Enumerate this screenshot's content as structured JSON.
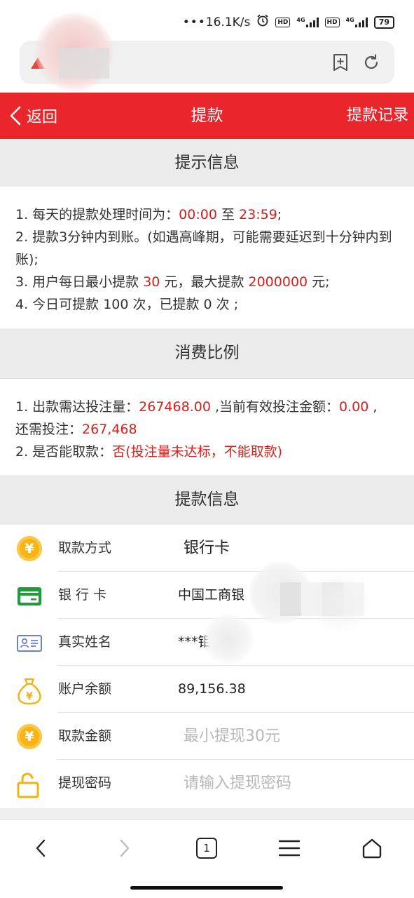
{
  "status_bar": {
    "network_speed": "16.1K/s",
    "hd1": "HD",
    "net1": "4G",
    "hd2": "HD",
    "net2": "4G",
    "battery": "79"
  },
  "browser": {
    "icons": [
      "warning-icon",
      "bookmark-add-icon",
      "refresh-icon"
    ]
  },
  "header": {
    "back_label": "返回",
    "title": "提款",
    "records_label": "提款记录"
  },
  "tips": {
    "title": "提示信息",
    "line1_prefix": "1. 每天的提款处理时间为：",
    "time_start": "00:00",
    "line1_mid": " 至 ",
    "time_end": "23:59",
    "line1_suffix": ";",
    "line2": "2. 提款3分钟内到账。(如遇高峰期，可能需要延迟到十分钟内到账);",
    "line3_prefix": "3. 用户每日最小提款 ",
    "min_amount": "30",
    "line3_mid": " 元，最大提款 ",
    "max_amount": "2000000",
    "line3_suffix": " 元;",
    "line4": "4. 今日可提款 100 次，已提款 0 次 ;"
  },
  "ratio": {
    "title": "消费比例",
    "line1_prefix": "1. 出款需达投注量：",
    "required_bet": "267468.00",
    "line1_mid": " ,当前有效投注金额：",
    "current_bet": "0.00",
    "line1_suffix": " ,",
    "line2_prefix": "还需投注：",
    "remaining_bet": "267,468",
    "line3_prefix": "2. 是否能取款：",
    "can_withdraw": "否(投注量未达标，不能取款)"
  },
  "withdraw": {
    "title": "提款信息",
    "method_label": "取款方式",
    "method_value": "银行卡",
    "bank_label": "银 行 卡",
    "bank_value": "中国工商银",
    "name_label": "真实姓名",
    "name_value": "***钼",
    "balance_label": "账户余额",
    "balance_value": "89,156.38",
    "amount_label": "取款金额",
    "amount_placeholder": "最小提现30元",
    "password_label": "提现密码",
    "password_placeholder": "请输入提现密码"
  },
  "bottom_nav": {
    "tab_count": "1"
  },
  "colors": {
    "header_red": "#e9262b",
    "value_red": "#d6201c",
    "coin_gold": "#f7b418",
    "card_green": "#1f9b3a",
    "id_card_blue": "#6c7fd8"
  }
}
